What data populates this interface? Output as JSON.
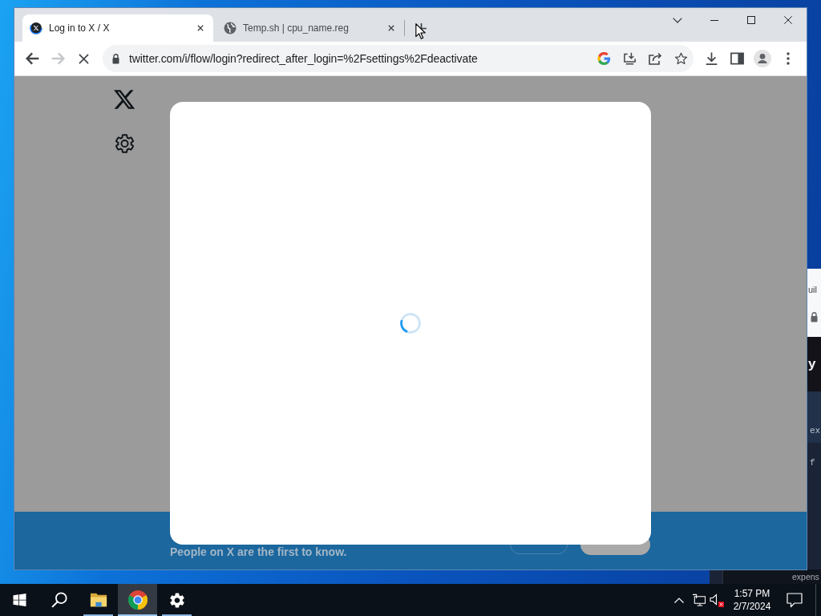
{
  "background_window": {
    "title_fragment": "uil",
    "heading_fragment": "y",
    "code_fragments": [
      "ex",
      "f"
    ],
    "footer_fragment": "expens"
  },
  "browser": {
    "tabs": [
      {
        "title": "Log in to X / X",
        "kind": "x",
        "selected": true
      },
      {
        "title": "Temp.sh | cpu_name.reg",
        "kind": "globe",
        "selected": false
      }
    ],
    "loading": true,
    "back_disabled": false,
    "forward_disabled": true,
    "address_bar": {
      "url": "twitter.com/i/flow/login?redirect_after_login=%2Fsettings%2Fdeactivate",
      "secure": true
    },
    "page": {
      "dimmed": true,
      "modal": {
        "loading": true
      },
      "banner": {
        "text": "People on X are the first to know."
      }
    }
  },
  "taskbar": {
    "apps": [
      {
        "kind": "start",
        "running": false,
        "selected": false
      },
      {
        "kind": "search",
        "running": false,
        "selected": false
      },
      {
        "kind": "explorer",
        "running": true,
        "selected": false
      },
      {
        "kind": "chrome",
        "running": true,
        "selected": true
      },
      {
        "kind": "settings",
        "running": true,
        "selected": false
      }
    ],
    "tray": {
      "muted": true,
      "time": "1:57 PM",
      "date": "2/7/2024"
    }
  }
}
